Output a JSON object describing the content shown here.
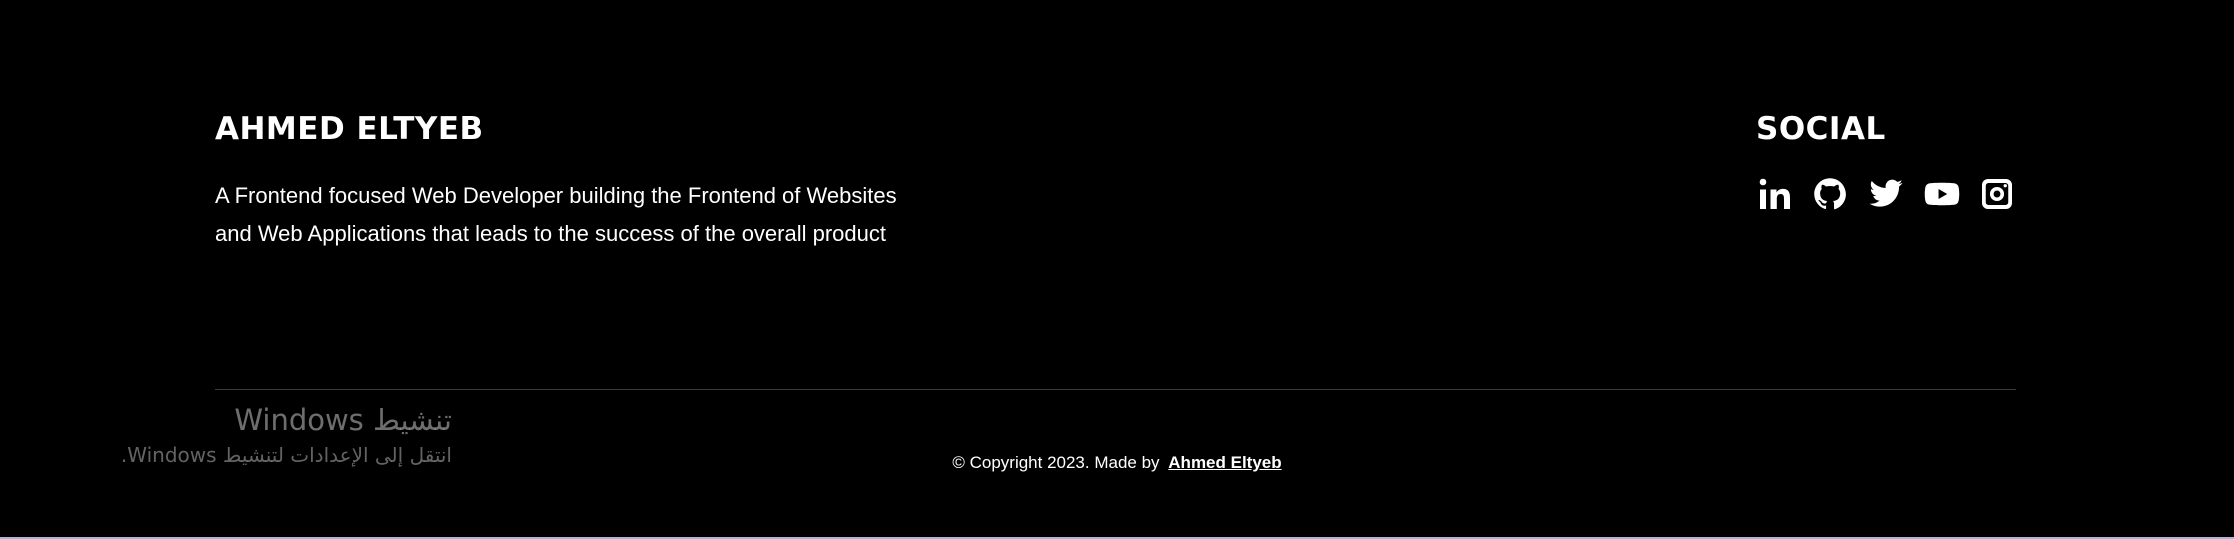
{
  "footer": {
    "brand_title": "AHMED ELTYEB",
    "brand_desc": "A Frontend focused Web Developer building the Frontend of Websites and Web Applications that leads to the success of the overall product",
    "social_title": "SOCIAL",
    "social_icons": [
      "linkedin-icon",
      "github-icon",
      "twitter-icon",
      "youtube-icon",
      "instagram-icon"
    ],
    "copyright_text": "© Copyright 2023. Made by",
    "copyright_author": "Ahmed Eltyeb"
  },
  "os_watermark": {
    "title": "تنشيط Windows",
    "subtitle": "انتقل إلى الإعدادات لتنشيط Windows."
  },
  "colors": {
    "background": "#000000",
    "text": "#ffffff",
    "divider": "#3a3a3a"
  }
}
